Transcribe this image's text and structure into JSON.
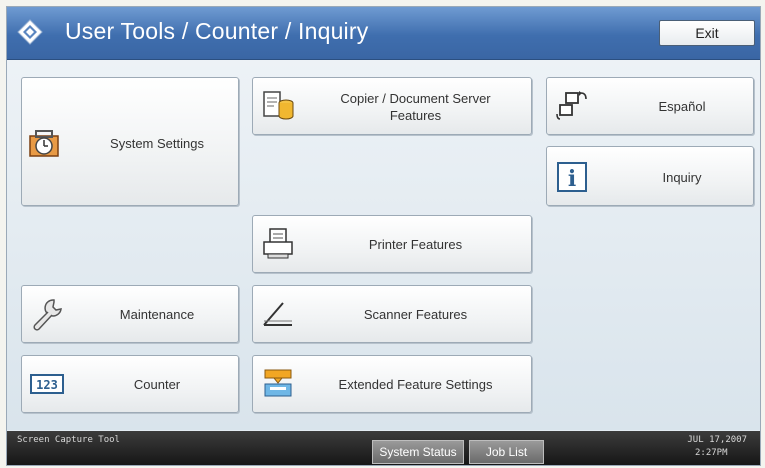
{
  "header": {
    "title": "User Tools / Counter / Inquiry",
    "exit_label": "Exit",
    "app_icon": "user-tools-icon"
  },
  "tiles": {
    "system_settings": {
      "label": "System Settings",
      "icon": "alarm-clock-icon"
    },
    "copier": {
      "label_line1": "Copier / Document Server",
      "label_line2": "Features",
      "icon": "document-server-icon"
    },
    "espanol": {
      "label": "Español",
      "icon": "language-switch-icon"
    },
    "inquiry": {
      "label": "Inquiry",
      "icon": "info-icon",
      "icon_text": "i"
    },
    "printer": {
      "label": "Printer Features",
      "icon": "printer-icon"
    },
    "maintenance": {
      "label": "Maintenance",
      "icon": "wrench-icon"
    },
    "scanner": {
      "label": "Scanner Features",
      "icon": "scanner-icon"
    },
    "counter": {
      "label": "Counter",
      "icon": "counter-icon",
      "icon_text": "123"
    },
    "extended": {
      "label": "Extended Feature Settings",
      "icon": "extended-feature-icon"
    }
  },
  "statusbar": {
    "left_text": "Screen Capture Tool",
    "system_status": "System Status",
    "job_list": "Job List",
    "date": "JUL  17,2007",
    "time": "2:27PM"
  },
  "colors": {
    "title_bar": "#3f6eae",
    "panel": "#e3ecf3",
    "status_bar": "#161616"
  }
}
